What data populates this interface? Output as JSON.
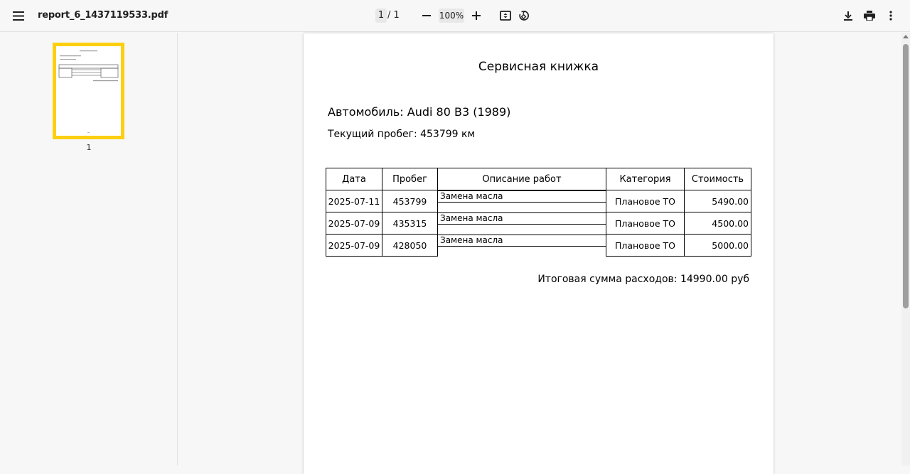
{
  "toolbar": {
    "file_name": "report_6_1437119533.pdf",
    "page_current": "1",
    "page_separator": "/ 1",
    "zoom": "100%"
  },
  "sidebar": {
    "thumbnail_label": "1"
  },
  "document": {
    "title": "Сервисная книжка",
    "car": "Автомобиль: Audi 80 B3 (1989)",
    "mileage": "Текущий пробег: 453799 км",
    "table": {
      "headers": [
        "Дата",
        "Пробег",
        "Описание работ",
        "Категория",
        "Стоимость"
      ],
      "rows": [
        [
          "2025-07-11",
          "453799",
          "Замена масла",
          "Плановое ТО",
          "5490.00"
        ],
        [
          "2025-07-09",
          "435315",
          "Замена масла",
          "Плановое ТО",
          "4500.00"
        ],
        [
          "2025-07-09",
          "428050",
          "Замена масла",
          "Плановое ТО",
          "5000.00"
        ]
      ]
    },
    "total": "Итоговая сумма расходов: 14990.00 руб"
  },
  "colors": {
    "thumbnail_border": "#fccf10",
    "toolbar_bg": "#f7f7f7"
  },
  "icons": [
    "menu-icon",
    "zoom-out-icon",
    "zoom-in-icon",
    "fit-page-icon",
    "rotate-icon",
    "download-icon",
    "print-icon",
    "more-vert-icon"
  ]
}
